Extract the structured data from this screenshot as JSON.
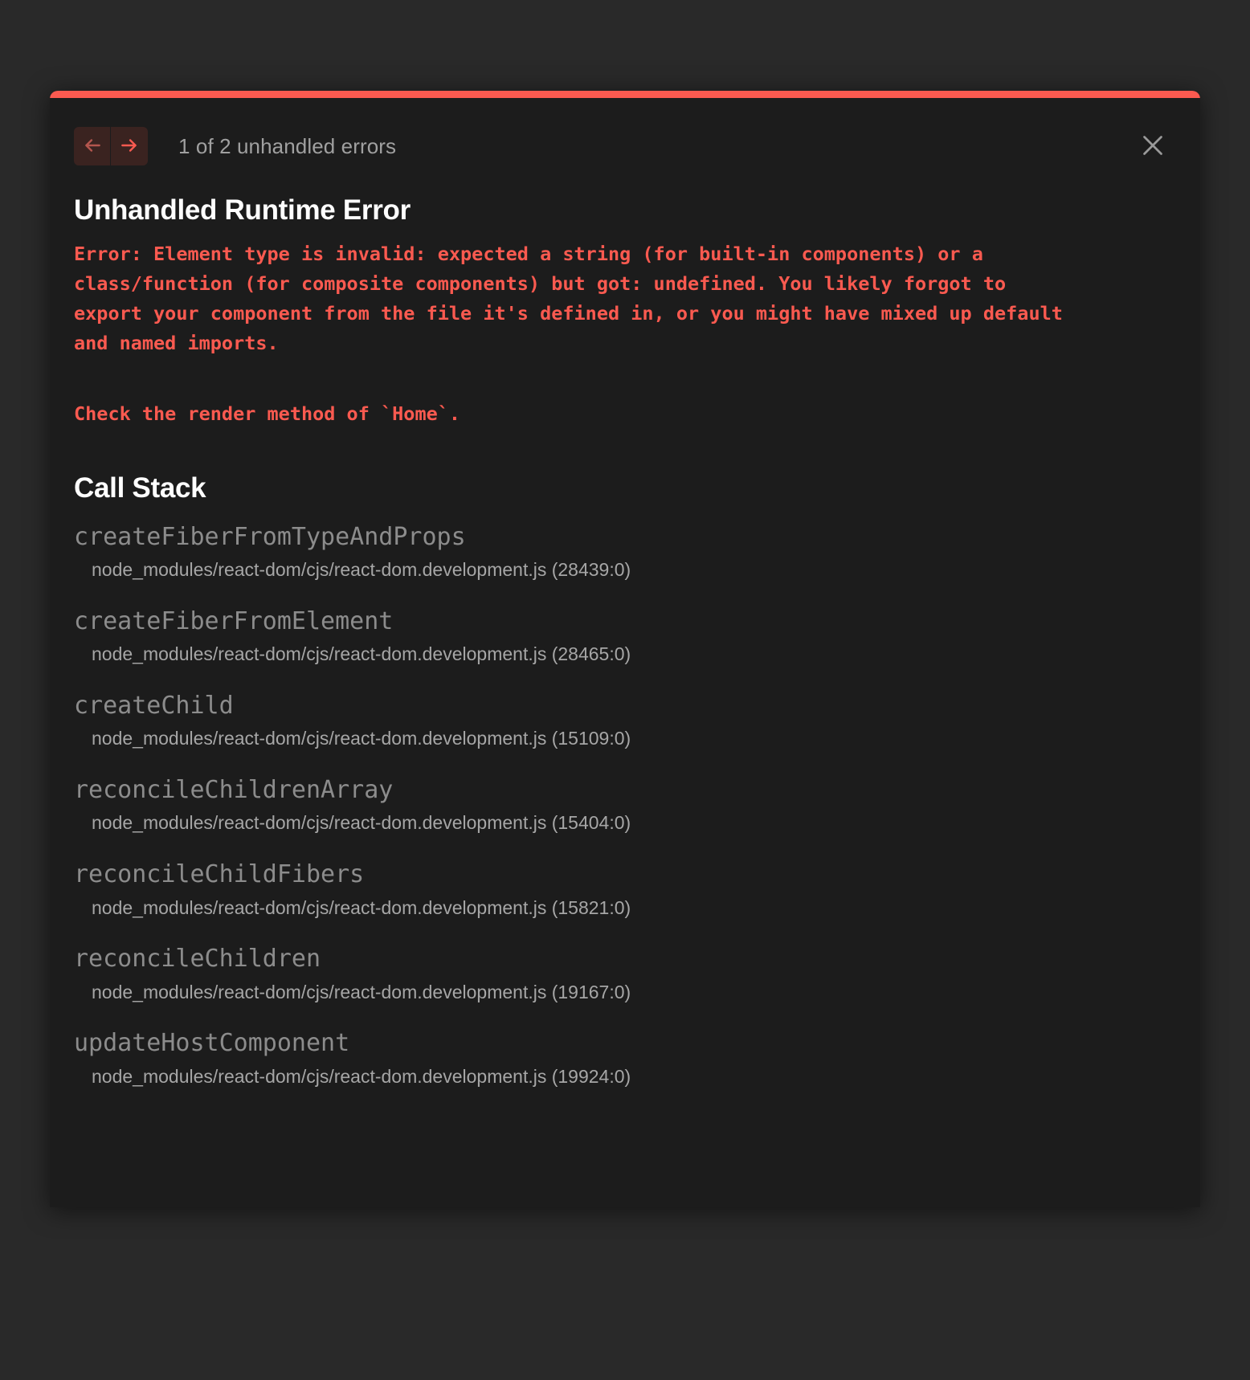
{
  "dialog": {
    "accent_color": "#fa5a50",
    "background_color": "#1c1c1c",
    "page_background_color": "#292929",
    "header": {
      "prev_icon": "arrow-left-icon",
      "next_icon": "arrow-right-icon",
      "error_count": "1 of 2 unhandled errors",
      "close_icon": "close-icon"
    },
    "error": {
      "title": "Unhandled Runtime Error",
      "message": "Error: Element type is invalid: expected a string (for built-in components) or a class/function (for composite components) but got: undefined. You likely forgot to export your component from the file it's defined in, or you might have mixed up default and named imports.",
      "hint": "Check the render method of `Home`."
    },
    "call_stack": {
      "title": "Call Stack",
      "frames": [
        {
          "function": "createFiberFromTypeAndProps",
          "location": "node_modules/react-dom/cjs/react-dom.development.js (28439:0)"
        },
        {
          "function": "createFiberFromElement",
          "location": "node_modules/react-dom/cjs/react-dom.development.js (28465:0)"
        },
        {
          "function": "createChild",
          "location": "node_modules/react-dom/cjs/react-dom.development.js (15109:0)"
        },
        {
          "function": "reconcileChildrenArray",
          "location": "node_modules/react-dom/cjs/react-dom.development.js (15404:0)"
        },
        {
          "function": "reconcileChildFibers",
          "location": "node_modules/react-dom/cjs/react-dom.development.js (15821:0)"
        },
        {
          "function": "reconcileChildren",
          "location": "node_modules/react-dom/cjs/react-dom.development.js (19167:0)"
        },
        {
          "function": "updateHostComponent",
          "location": "node_modules/react-dom/cjs/react-dom.development.js (19924:0)"
        }
      ]
    }
  }
}
